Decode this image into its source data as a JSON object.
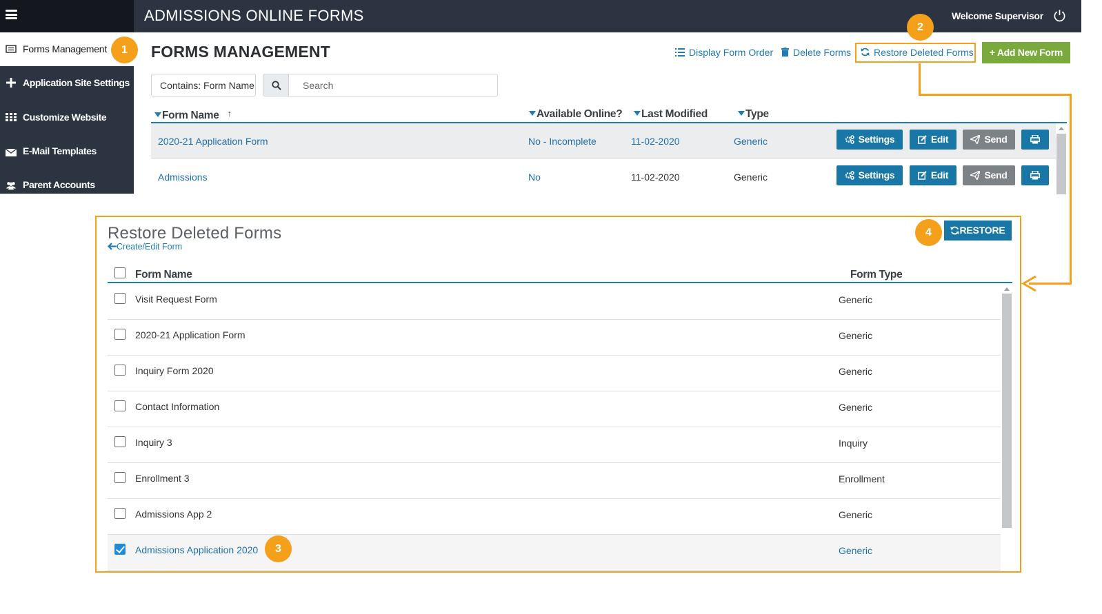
{
  "header": {
    "app_title": "ADMISSIONS ONLINE FORMS",
    "welcome": "Welcome Supervisor"
  },
  "sidebar": {
    "items": [
      {
        "label": "Forms Management",
        "icon": "form-list-icon"
      },
      {
        "label": "Application Site Settings",
        "icon": "plus-icon"
      },
      {
        "label": "Customize Website",
        "icon": "grid-icon"
      },
      {
        "label": "E-Mail Templates",
        "icon": "envelope-icon"
      },
      {
        "label": "Parent Accounts",
        "icon": "users-icon"
      }
    ]
  },
  "badges": {
    "b1": "1",
    "b2": "2",
    "b3": "3",
    "b4": "4"
  },
  "main": {
    "title": "FORMS MANAGEMENT",
    "toolbar": {
      "display_order": "Display Form Order",
      "delete_forms": "Delete Forms",
      "restore_deleted": "Restore Deleted Forms",
      "add_new": "+ Add New Form"
    },
    "filter": {
      "select_value": "Contains: Form Name",
      "search_placeholder": "Search"
    },
    "columns": {
      "form_name": "Form Name",
      "available": "Available Online?",
      "modified": "Last Modified",
      "type": "Type"
    },
    "rows": [
      {
        "name": "2020-21 Application Form",
        "available": "No - Incomplete",
        "modified": "11-02-2020",
        "type": "Generic"
      },
      {
        "name": "Admissions",
        "available": "No",
        "modified": "11-02-2020",
        "type": "Generic"
      }
    ],
    "row_buttons": {
      "settings": "Settings",
      "edit": "Edit",
      "send": "Send"
    }
  },
  "restore_panel": {
    "title": "Restore Deleted Forms",
    "back_link": "Create/Edit Form",
    "restore_button": "RESTORE",
    "columns": {
      "form_name": "Form Name",
      "form_type": "Form Type"
    },
    "rows": [
      {
        "name": "Visit Request Form",
        "type": "Generic",
        "checked": false
      },
      {
        "name": "2020-21 Application Form",
        "type": "Generic",
        "checked": false
      },
      {
        "name": "Inquiry Form 2020",
        "type": "Generic",
        "checked": false
      },
      {
        "name": "Contact Information",
        "type": "Generic",
        "checked": false
      },
      {
        "name": "Inquiry 3",
        "type": "Inquiry",
        "checked": false
      },
      {
        "name": "Enrollment 3",
        "type": "Enrollment",
        "checked": false
      },
      {
        "name": "Admissions App 2",
        "type": "Generic",
        "checked": false
      },
      {
        "name": "Admissions Application 2020",
        "type": "Generic",
        "checked": true
      }
    ]
  },
  "colors": {
    "topbar": "#2b3440",
    "accent_blue": "#1877a6",
    "link_blue": "#1f7bb6",
    "highlight_orange": "#f5a01a",
    "add_green": "#7aa93c"
  }
}
